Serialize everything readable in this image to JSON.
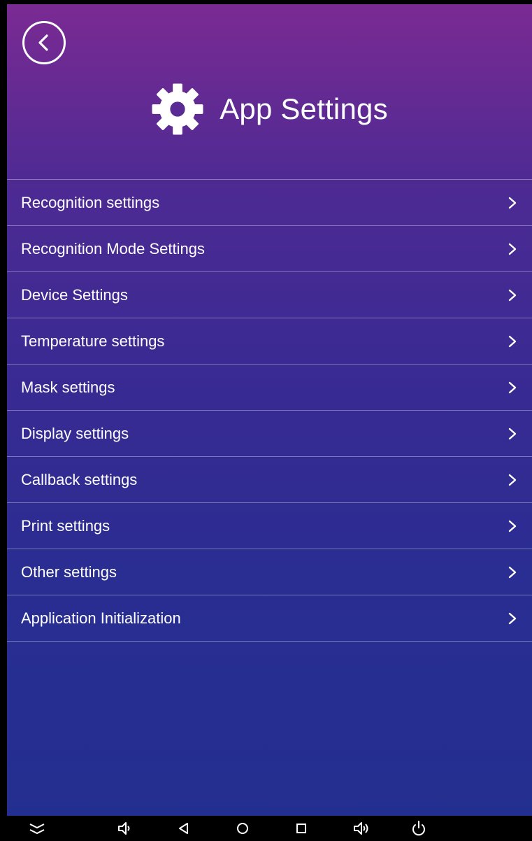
{
  "header": {
    "title": "App Settings"
  },
  "menu": {
    "items": [
      {
        "label": "Recognition settings"
      },
      {
        "label": "Recognition Mode Settings"
      },
      {
        "label": "Device Settings"
      },
      {
        "label": "Temperature settings"
      },
      {
        "label": "Mask settings"
      },
      {
        "label": "Display settings"
      },
      {
        "label": "Callback settings"
      },
      {
        "label": "Print settings"
      },
      {
        "label": "Other settings"
      },
      {
        "label": "Application Initialization"
      }
    ]
  },
  "icons": {
    "back": "back-arrow-icon",
    "settings": "gear-icon",
    "chevron": "chevron-right-icon",
    "nav": [
      "collapse-icon",
      "volume-down-icon",
      "back-triangle-icon",
      "home-circle-icon",
      "recents-square-icon",
      "volume-up-icon",
      "power-icon"
    ]
  },
  "colors": {
    "gradient_top": "#7b2a93",
    "gradient_bottom": "#232f90",
    "text": "#ffffff",
    "navbar": "#000000"
  }
}
